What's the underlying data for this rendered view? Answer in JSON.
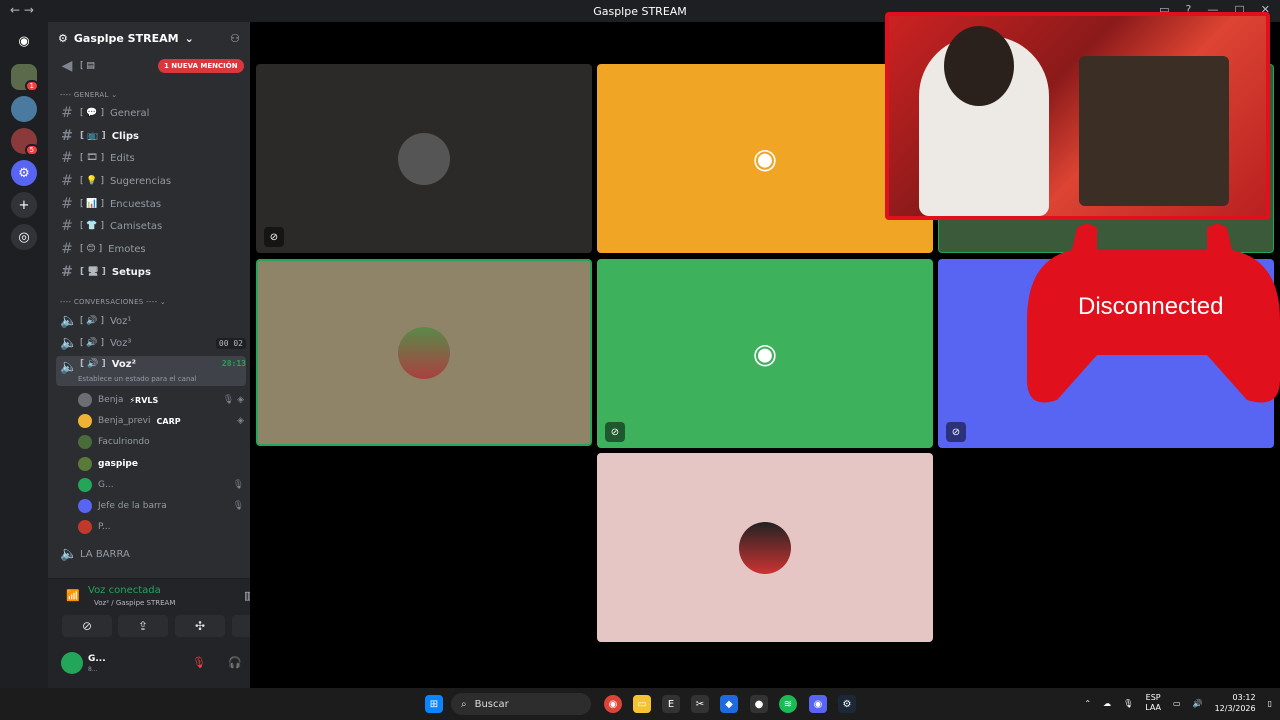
{
  "window": {
    "title": "Gasplpe STREAM"
  },
  "server": {
    "name": "Gasplpe STREAM",
    "mention_badge": "1 NUEVA MENCIÓN"
  },
  "categories": {
    "general": "GENERAL",
    "voice": "CONVERSACIONES"
  },
  "channels": [
    {
      "label": "General",
      "bold": false
    },
    {
      "label": "Clips",
      "bold": true
    },
    {
      "label": "Edits",
      "bold": false
    },
    {
      "label": "Sugerencias",
      "bold": false
    },
    {
      "label": "Encuestas",
      "bold": false
    },
    {
      "label": "Camisetas",
      "bold": false
    },
    {
      "label": "Emotes",
      "bold": false
    },
    {
      "label": "Setups",
      "bold": true
    }
  ],
  "voice_channels": [
    {
      "label": "Voz¹",
      "timer": ""
    },
    {
      "label": "Voz³",
      "timer": "00 02"
    },
    {
      "label": "Voz²",
      "timer": "28:13",
      "status": "Establece un estado para el canal"
    }
  ],
  "members": [
    {
      "name": "Benja",
      "tag": "⚡RVLS",
      "color": "#6b6f75"
    },
    {
      "name": "Benja_previ",
      "tag": "CARP",
      "color": "#f0b232"
    },
    {
      "name": "Faculriondo",
      "tag": "",
      "color": "#4a6b3a"
    },
    {
      "name": "gaspipe",
      "tag": "",
      "color": "#5a7a3a"
    },
    {
      "name": "G...",
      "tag": "",
      "color": "#23a55a"
    },
    {
      "name": "Jefe de la barra",
      "tag": "",
      "color": "#5865f2"
    },
    {
      "name": "P...",
      "tag": "",
      "color": "#c0392b"
    }
  ],
  "other_channel": "LA BARRA",
  "voice_panel": {
    "status": "Voz conectada",
    "channel": "Voz² / Gaspipe STREAM"
  },
  "user_panel": {
    "name": "G...",
    "sub": "8..."
  },
  "overlay": {
    "text": "Disconnected"
  },
  "tiles": [
    {
      "bg": "#2b2a29"
    },
    {
      "bg": "#f0a524"
    },
    {
      "bg": "#8f8468"
    },
    {
      "bg": "#3eb15d"
    },
    {
      "bg": "#5865f2"
    },
    {
      "bg": "#e6c6c4"
    }
  ],
  "taskbar": {
    "search_placeholder": "Buscar",
    "lang": "ESP",
    "lang2": "LAA",
    "time": "03:12",
    "date": "12/3/2026"
  },
  "colors": {
    "accent": "#5865f2",
    "online": "#23a55a",
    "alert": "#da373c"
  }
}
